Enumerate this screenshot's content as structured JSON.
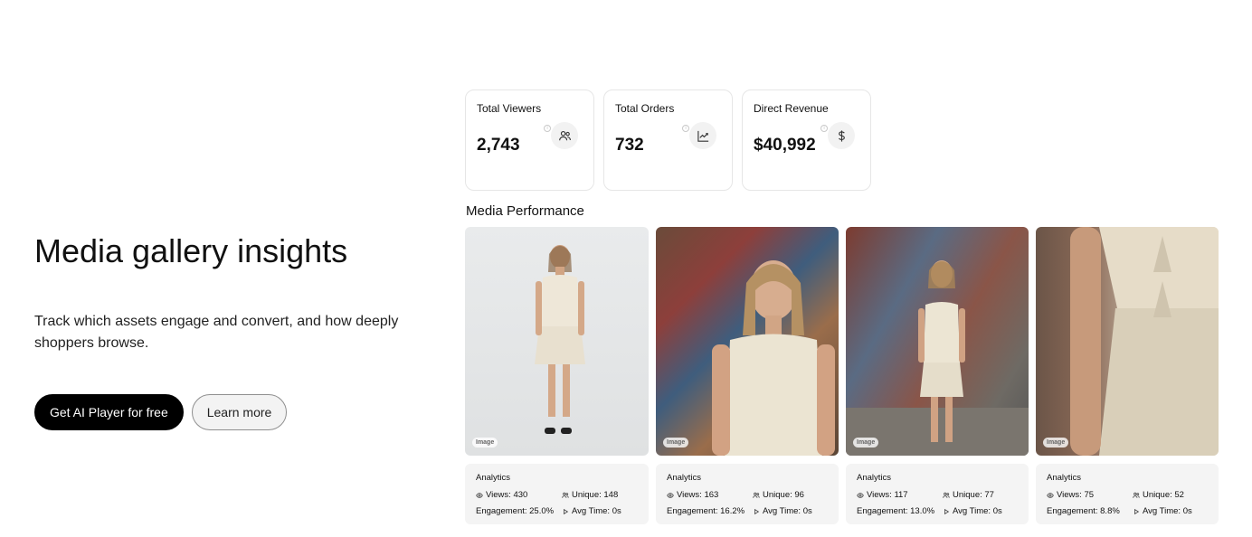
{
  "hero": {
    "title": "Media gallery insights",
    "description": "Track which assets engage and convert, and how deeply shoppers browse.",
    "primary_cta": "Get AI Player for free",
    "secondary_cta": "Learn more"
  },
  "stats": [
    {
      "label": "Total Viewers",
      "value": "2,743",
      "icon": "users-icon"
    },
    {
      "label": "Total Orders",
      "value": "732",
      "icon": "trend-chart-icon"
    },
    {
      "label": "Direct Revenue",
      "value": "$40,992",
      "icon": "dollar-icon"
    }
  ],
  "media_performance": {
    "title": "Media Performance",
    "items": [
      {
        "tag": "Image",
        "analytics_label": "Analytics",
        "views": "Views: 430",
        "unique": "Unique: 148",
        "engagement": "Engagement: 25.0%",
        "avg_time": "Avg Time: 0s"
      },
      {
        "tag": "Image",
        "analytics_label": "Analytics",
        "views": "Views: 163",
        "unique": "Unique: 96",
        "engagement": "Engagement: 16.2%",
        "avg_time": "Avg Time: 0s"
      },
      {
        "tag": "Image",
        "analytics_label": "Analytics",
        "views": "Views: 117",
        "unique": "Unique: 77",
        "engagement": "Engagement: 13.0%",
        "avg_time": "Avg Time: 0s"
      },
      {
        "tag": "Image",
        "analytics_label": "Analytics",
        "views": "Views: 75",
        "unique": "Unique: 52",
        "engagement": "Engagement: 8.8%",
        "avg_time": "Avg Time: 0s"
      }
    ]
  }
}
